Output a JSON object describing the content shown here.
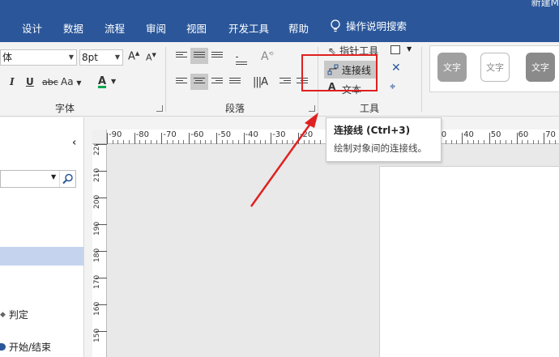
{
  "menubar": {
    "items": [
      "设计",
      "数据",
      "流程",
      "审阅",
      "视图",
      "开发工具",
      "帮助"
    ],
    "tell_me": "操作说明搜索",
    "doc_title": "新建M",
    "bg": "#2b579a"
  },
  "ribbon": {
    "font": {
      "family_value": "体",
      "size_value": "8pt",
      "group_label": "字体",
      "italic": "I",
      "underline": "U",
      "strike": "abc",
      "case": "Aa"
    },
    "paragraph": {
      "group_label": "段落"
    },
    "tools": {
      "group_label": "工具",
      "pointer_label": "指针工具",
      "connector_label": "连接线",
      "text_label": "文本"
    },
    "styles": {
      "swatch_label": "文字"
    }
  },
  "tooltip": {
    "title": "连接线 (Ctrl+3)",
    "description": "绘制对象间的连接线。"
  },
  "leftpane": {
    "shapes": [
      "判定",
      "开始/结束"
    ]
  },
  "ruler": {
    "h_ticks": [
      "-90",
      "-80",
      "-70",
      "-60",
      "-50",
      "-40",
      "-30",
      "-20",
      "-10",
      "0",
      "10",
      "20",
      "30",
      "40",
      "50",
      "60",
      "70"
    ],
    "v_ticks": [
      "220",
      "210",
      "200",
      "190",
      "180",
      "170",
      "160",
      "150"
    ]
  },
  "colors": {
    "annotation": "#e02020",
    "selection": "#c5d3ef",
    "font_color_bar": "#00a650"
  }
}
